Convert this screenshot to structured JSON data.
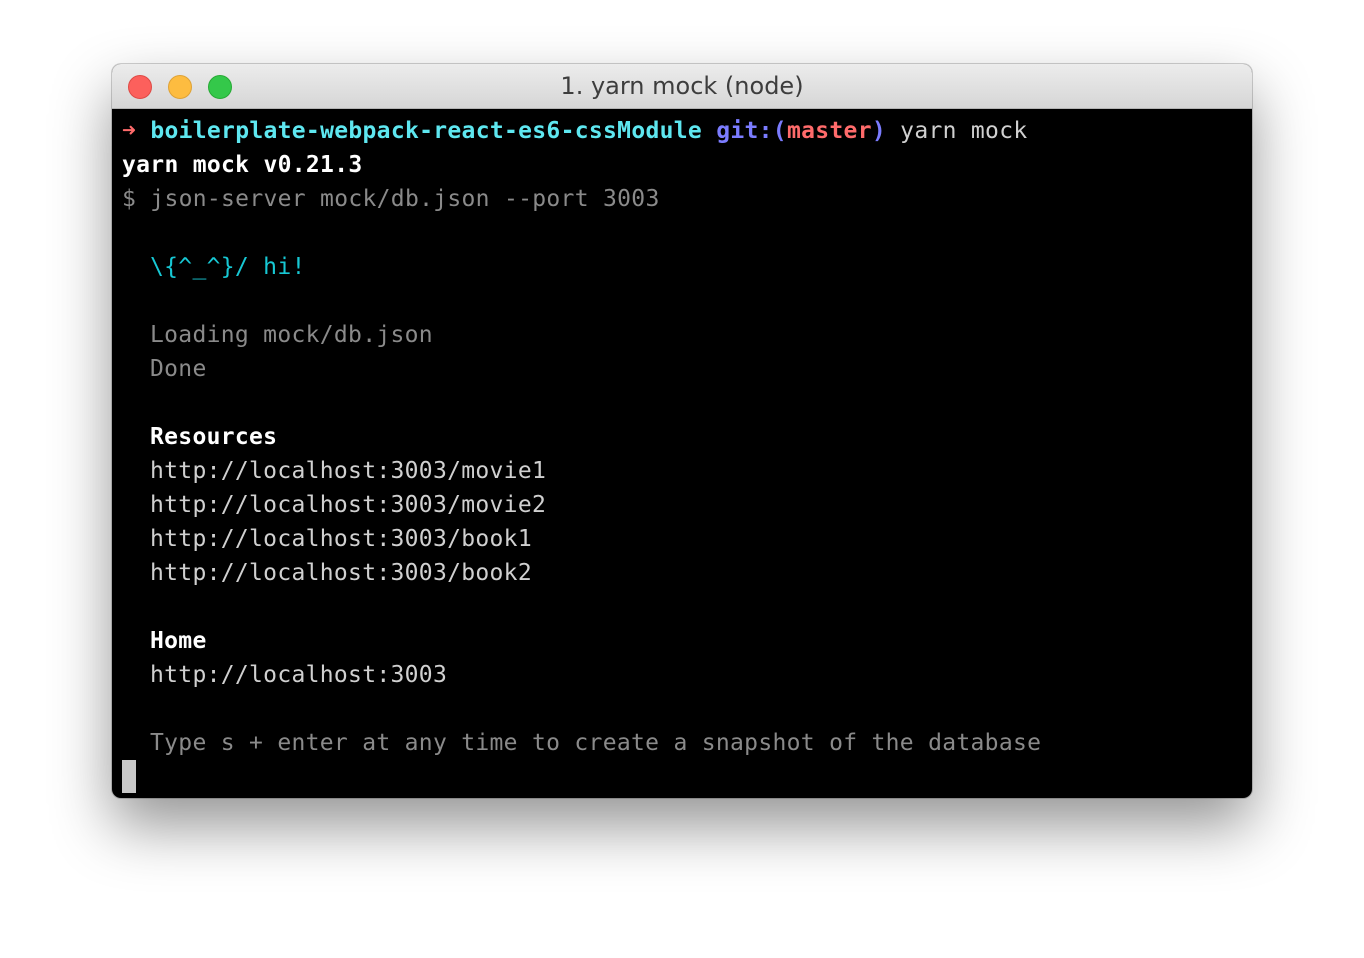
{
  "window": {
    "title": "1. yarn mock (node)"
  },
  "prompt": {
    "arrow": "➜",
    "directory": "boilerplate-webpack-react-es6-cssModule",
    "git_prefix": "git:(",
    "branch": "master",
    "git_suffix": ")",
    "command": "yarn mock"
  },
  "output": {
    "yarn_version": "yarn mock v0.21.3",
    "script_command": "$ json-server mock/db.json --port 3003",
    "greeting": "\\{^_^}/ hi!",
    "loading": "Loading mock/db.json",
    "done": "Done",
    "resources_heading": "Resources",
    "resources": [
      "http://localhost:3003/movie1",
      "http://localhost:3003/movie2",
      "http://localhost:3003/book1",
      "http://localhost:3003/book2"
    ],
    "home_heading": "Home",
    "home_url": "http://localhost:3003",
    "hint": "Type s + enter at any time to create a snapshot of the database"
  },
  "colors": {
    "arrow": "#ff6b6b",
    "directory": "#5ee7f0",
    "git": "#7b7cff",
    "branch": "#ff6b6b",
    "greeting": "#17c8d4",
    "dim_text": "#8a8a8a",
    "background": "#000000"
  }
}
